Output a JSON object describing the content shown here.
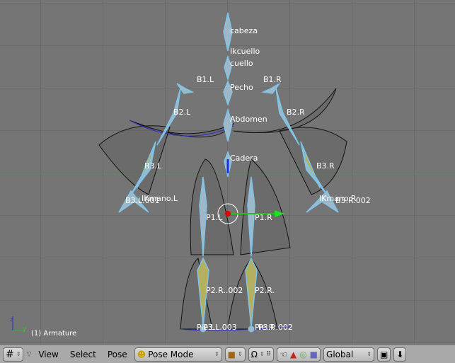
{
  "viewport": {
    "bones": {
      "cabeza": "cabeza",
      "ikcuello": "Ikcuello",
      "cuello": "cuello",
      "b1l": "B1.L",
      "b1r": "B1.R",
      "pecho": "Pecho",
      "b2l": "B2.L",
      "b2r": "B2.R",
      "abdomen": "Abdomen",
      "cadera": "Cadera",
      "b3l": "B3.L",
      "b3r": "B3.R",
      "ikmanol": "IKmano.L",
      "b3l001": "B3.L.001",
      "ikmanor": "IKmano.R",
      "b3r002": "B3.R.002",
      "p1l": "P1.L",
      "p1r": "P1.R",
      "p2r002": "P2.R..002",
      "p2r": "P2.R.",
      "piel": "Pie.L",
      "p3l003": "P3.L.003",
      "pier": "Pie.R",
      "p3r002": "P3.R.002"
    },
    "status": "(1) Armature",
    "axis": {
      "z": "z",
      "y": "y"
    }
  },
  "toolbar": {
    "view": "View",
    "select": "Select",
    "pose": "Pose",
    "mode": "Pose Mode",
    "orientation": "Global"
  },
  "colors": {
    "bone": "#7fc4e8",
    "bone_fill": "#9fb8c8",
    "selected_bone": "#b5b060",
    "background": "#757575",
    "toolbar": "#a9a9a9"
  }
}
